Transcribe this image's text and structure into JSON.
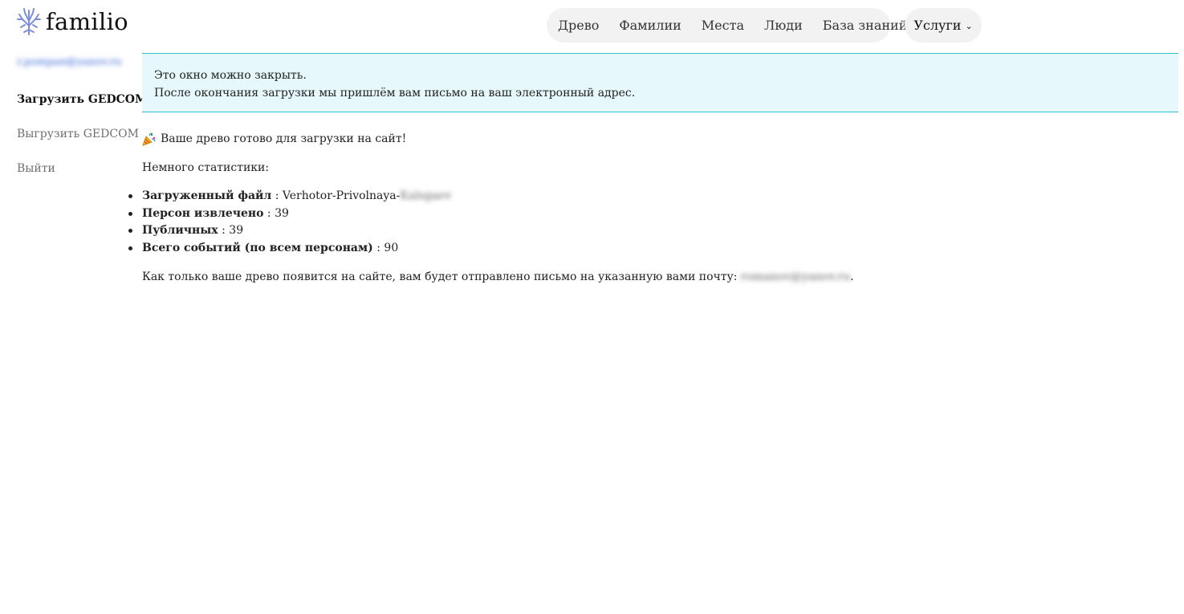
{
  "header": {
    "logo_text": "familio",
    "logo_icon": "tree-icon",
    "nav": [
      "Древо",
      "Фамилии",
      "Места",
      "Люди",
      "База знаний"
    ],
    "services_label": "Услуги",
    "services_icon": "chevron-down-icon"
  },
  "sidebar": {
    "user_email": "r.pompan@yanov.ru",
    "items": [
      {
        "label": "Загрузить GEDCOM",
        "active": true
      },
      {
        "label": "Выгрузить GEDCOM",
        "active": false
      },
      {
        "label": "Выйти",
        "active": false
      }
    ]
  },
  "alert": {
    "line1": "Это окно можно закрыть.",
    "line2": "После окончания загрузки мы пришлём вам письмо на ваш электронный адрес."
  },
  "content": {
    "party_icon": "party-popper-icon",
    "ready_text": "Ваше древо готово для загрузки на сайт!",
    "stats_title": "Немного статистики:",
    "stats": [
      {
        "label": "Загруженный файл",
        "value": "Verhotor-Privolnaya-",
        "blurred_suffix": "Kalsgaev"
      },
      {
        "label": "Персон извлечено",
        "value": "39"
      },
      {
        "label": "Публичных",
        "value": "39"
      },
      {
        "label": "Всего событий (по всем персонам)",
        "value": "90"
      }
    ],
    "final_text": "Как только ваше древо появится на сайте, вам будет отправлено письмо на указанную вами почту:",
    "final_email": "romanov@yanov.ru",
    "final_period": "."
  },
  "colors": {
    "logo_icon": "#7b8fdc",
    "alert_bg": "#e6f8fb",
    "alert_border": "#2fc3d1",
    "nav_bg": "#f2f2f2"
  }
}
